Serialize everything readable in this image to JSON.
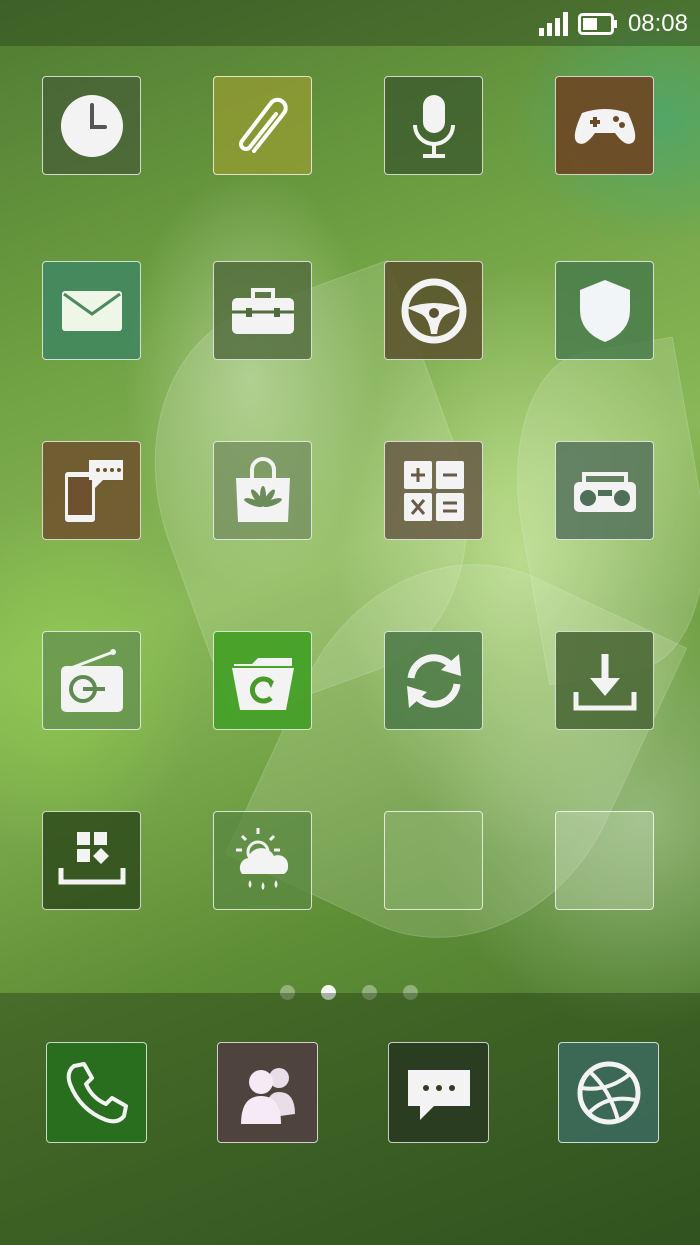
{
  "status_bar": {
    "time": "08:08"
  },
  "home": {
    "page_index": 1,
    "page_count": 4
  },
  "colors": {
    "clock": "#56703f",
    "attach": "#8a9a3a",
    "recorder": "#4d6d38",
    "games": "#6b4a28",
    "mail": "#4c8a5e",
    "toolbox": "#506c3c",
    "drive": "#5a5230",
    "security": "#4f7f50",
    "sms_phone": "#6e5230",
    "appstore": "#6c8c58",
    "calculator": "#6a5a45",
    "radio_tape": "#4f6f58",
    "fm_radio": "#5f8b52",
    "file_manager": "#4a9a2a",
    "sync": "#4f7a48",
    "download": "#4d6a38",
    "themes": "#39561f",
    "weather": "#5e8a45",
    "empty": "#8fb07a",
    "phone": "#2e6d1f",
    "contacts": "#50413f",
    "messages": "#2e3e25",
    "dribbble": "#3f6a5a"
  }
}
